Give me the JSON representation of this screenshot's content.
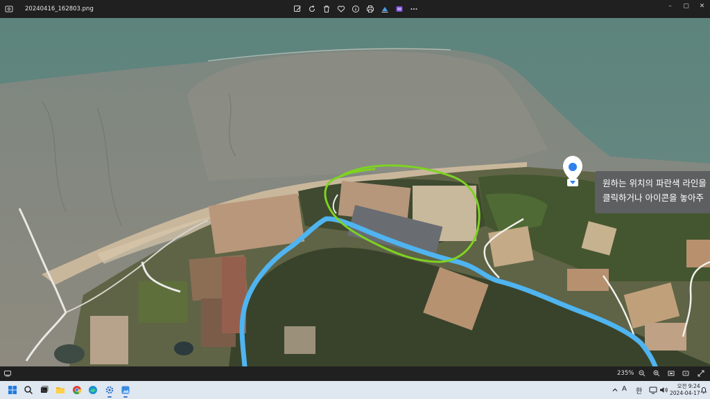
{
  "window": {
    "filename": "20240416_162803.png"
  },
  "toolbar": {
    "tools": [
      "edit-image-icon",
      "rotate-icon",
      "delete-icon",
      "favorite-icon",
      "info-icon",
      "print-icon",
      "erase-icon",
      "clipchamp-icon",
      "more-icon"
    ]
  },
  "window_controls": {
    "minimize": "–",
    "maximize": "▢",
    "close": "✕"
  },
  "map": {
    "callout_line1": "원하는 위치의 파란색 라인을",
    "callout_line2": "클릭하거나 아이콘을 놓아주",
    "route_color": "#4fb4f0",
    "highlight_color": "#7ed321",
    "pin_color": "#2f80ed"
  },
  "statusbar": {
    "zoom": "235%"
  },
  "taskbar": {
    "apps": [
      "start-icon",
      "search-icon",
      "task-view-icon",
      "file-explorer-icon",
      "chrome-icon",
      "edge-icon",
      "settings-icon",
      "photos-icon"
    ],
    "tray_lang_a": "A",
    "tray_lang_han": "한",
    "clock_time": "오전 9:24",
    "clock_date": "2024-04-17"
  }
}
